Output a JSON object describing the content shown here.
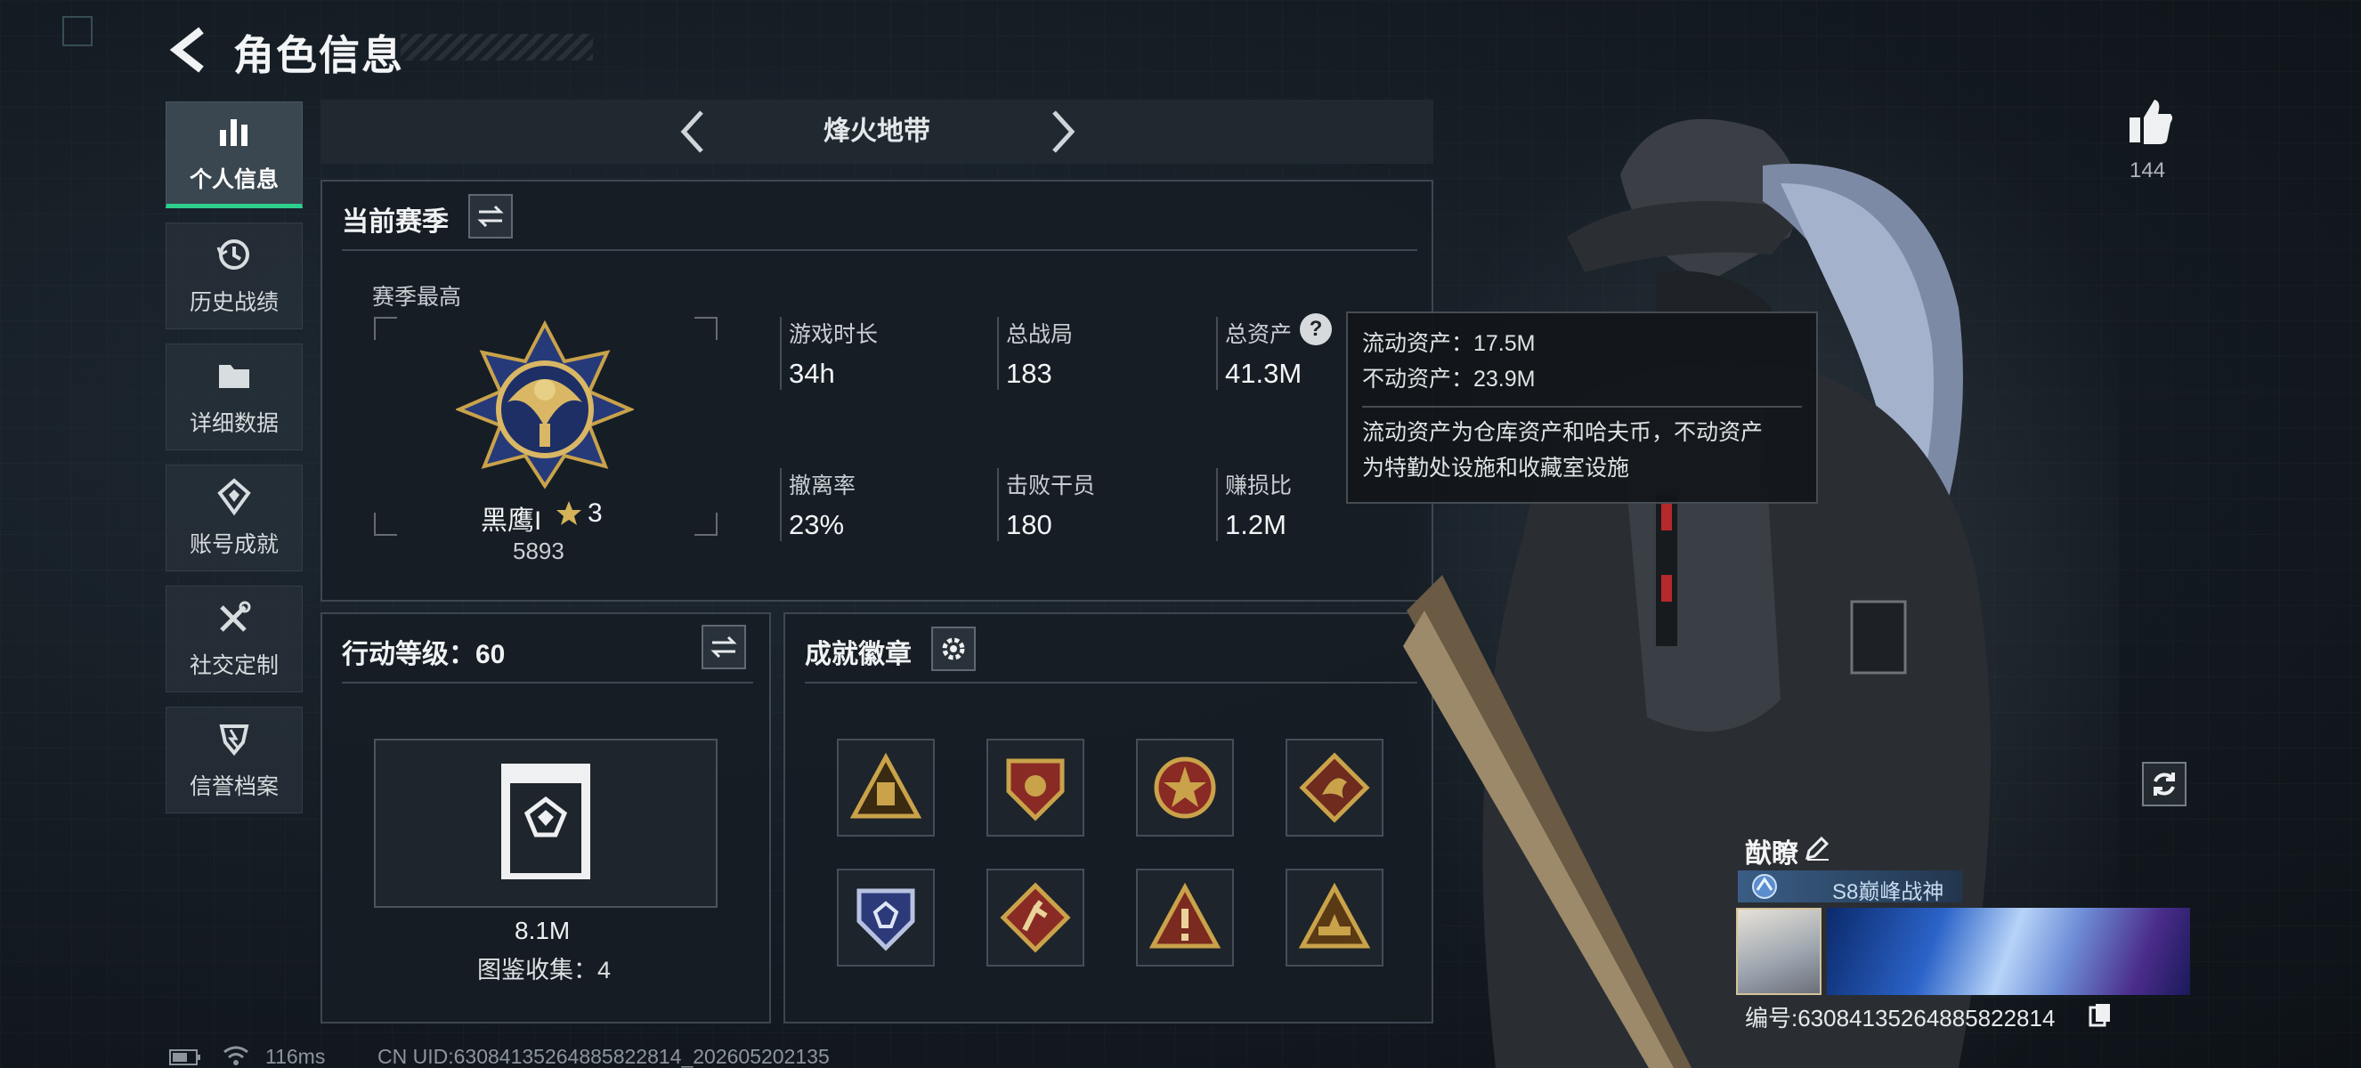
{
  "header": {
    "title": "角色信息"
  },
  "nav": [
    {
      "label": "个人信息",
      "icon": "bar-chart-icon",
      "active": true
    },
    {
      "label": "历史战绩",
      "icon": "history-icon",
      "active": false
    },
    {
      "label": "详细数据",
      "icon": "folder-icon",
      "active": false
    },
    {
      "label": "账号成就",
      "icon": "achievement-icon",
      "active": false
    },
    {
      "label": "社交定制",
      "icon": "tools-icon",
      "active": false
    },
    {
      "label": "信誉档案",
      "icon": "shield-icon",
      "active": false
    }
  ],
  "mode": {
    "name": "烽火地带"
  },
  "season": {
    "title": "当前赛季",
    "best_label": "赛季最高",
    "rank_name": "黑鹰I",
    "rank_stars": "3",
    "rank_score": "5893",
    "stats": [
      {
        "label": "游戏时长",
        "value": "34h"
      },
      {
        "label": "总战局",
        "value": "183"
      },
      {
        "label": "总资产",
        "value": "41.3M"
      },
      {
        "label": "撤离率",
        "value": "23%"
      },
      {
        "label": "击败干员",
        "value": "180"
      },
      {
        "label": "赚损比",
        "value": "1.2M"
      }
    ]
  },
  "tooltip": {
    "line1": "流动资产：17.5M",
    "line2": "不动资产：23.9M",
    "desc1": "流动资产为仓库资产和哈夫币，不动资产",
    "desc2": "为特勤处设施和收藏室设施"
  },
  "action_level": {
    "title": "行动等级：60",
    "value": "8.1M",
    "collection": "图鉴收集：4"
  },
  "badges": {
    "title": "成就徽章"
  },
  "likes": {
    "count": "144"
  },
  "player": {
    "name": "猷瞭",
    "title": "S8巅峰战神",
    "uid": "编号:63084135264885822814"
  },
  "footer": {
    "ping": "116ms",
    "uid": "CN UID:63084135264885822814_202605202135"
  },
  "colors": {
    "accent": "#2ecf8d",
    "badge_gold": "#c9a24a",
    "badge_red": "#a33a2c"
  }
}
